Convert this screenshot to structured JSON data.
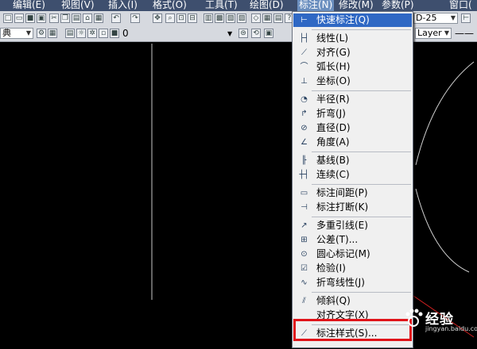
{
  "menubar": {
    "items": [
      {
        "label": "编辑(E)"
      },
      {
        "label": "视图(V)"
      },
      {
        "label": "插入(I)"
      },
      {
        "label": "格式(O)"
      },
      {
        "label": "工具(T)"
      },
      {
        "label": "绘图(D)"
      },
      {
        "label": "标注(N)"
      },
      {
        "label": "修改(M)"
      },
      {
        "label": "参数(P)"
      },
      {
        "label": "窗口("
      }
    ]
  },
  "toolbar1": {
    "dimstyle_value": "D-25"
  },
  "toolbar2": {
    "style_value": "典",
    "layer_value": "0",
    "linetype_value": "Layer"
  },
  "dropdown": {
    "items": [
      {
        "label": "快速标注(Q)",
        "icon": "quick-dimension-icon"
      },
      {
        "label": "线性(L)",
        "icon": "linear-icon"
      },
      {
        "label": "对齐(G)",
        "icon": "aligned-icon"
      },
      {
        "label": "弧长(H)",
        "icon": "arc-length-icon"
      },
      {
        "label": "坐标(O)",
        "icon": "ordinate-icon"
      },
      {
        "label": "半径(R)",
        "icon": "radius-icon"
      },
      {
        "label": "折弯(J)",
        "icon": "jogged-icon"
      },
      {
        "label": "直径(D)",
        "icon": "diameter-icon"
      },
      {
        "label": "角度(A)",
        "icon": "angular-icon"
      },
      {
        "label": "基线(B)",
        "icon": "baseline-icon"
      },
      {
        "label": "连续(C)",
        "icon": "continue-icon"
      },
      {
        "label": "标注间距(P)",
        "icon": "dim-space-icon"
      },
      {
        "label": "标注打断(K)",
        "icon": "dim-break-icon"
      },
      {
        "label": "多重引线(E)",
        "icon": "multileader-icon"
      },
      {
        "label": "公差(T)...",
        "icon": "tolerance-icon"
      },
      {
        "label": "圆心标记(M)",
        "icon": "center-mark-icon"
      },
      {
        "label": "检验(I)",
        "icon": "inspection-icon"
      },
      {
        "label": "折弯线性(J)",
        "icon": "jogged-linear-icon"
      },
      {
        "label": "倾斜(Q)",
        "icon": "oblique-icon"
      },
      {
        "label": "对齐文字(X)",
        "icon": ""
      },
      {
        "label": "标注样式(S)...",
        "icon": "dim-style-icon"
      }
    ]
  },
  "colors": {
    "highlight": "#2f68c4",
    "callout": "#e0141a"
  },
  "watermark": {
    "text": "经验",
    "url": "jingyan.baidu.com"
  }
}
